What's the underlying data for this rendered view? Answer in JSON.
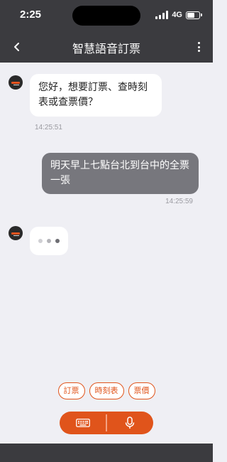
{
  "status_bar": {
    "time": "2:25",
    "network": "4G",
    "battery_level_pct": 60
  },
  "header": {
    "title": "智慧語音訂票"
  },
  "messages": [
    {
      "from": "bot",
      "text_line1": "您好，想要訂票、查時刻",
      "text_line2": "表或查票價？",
      "time": "14:25:51"
    },
    {
      "from": "user",
      "text_line1": "明天早上七點台北到台中的全票",
      "text_line2": "一張",
      "time": "14:25:59"
    },
    {
      "from": "bot",
      "typing": true
    }
  ],
  "quick_replies": [
    "訂票",
    "時刻表",
    "票價"
  ],
  "icons": {
    "back": "chevron-left-icon",
    "more": "vertical-dots-icon",
    "keyboard": "keyboard-icon",
    "mic": "microphone-icon"
  },
  "colors": {
    "accent": "#e0541b",
    "header_bg": "#3b3b3f",
    "chat_bg": "#efeff4",
    "user_bubble": "#77777d",
    "bot_bubble": "#ffffff"
  }
}
